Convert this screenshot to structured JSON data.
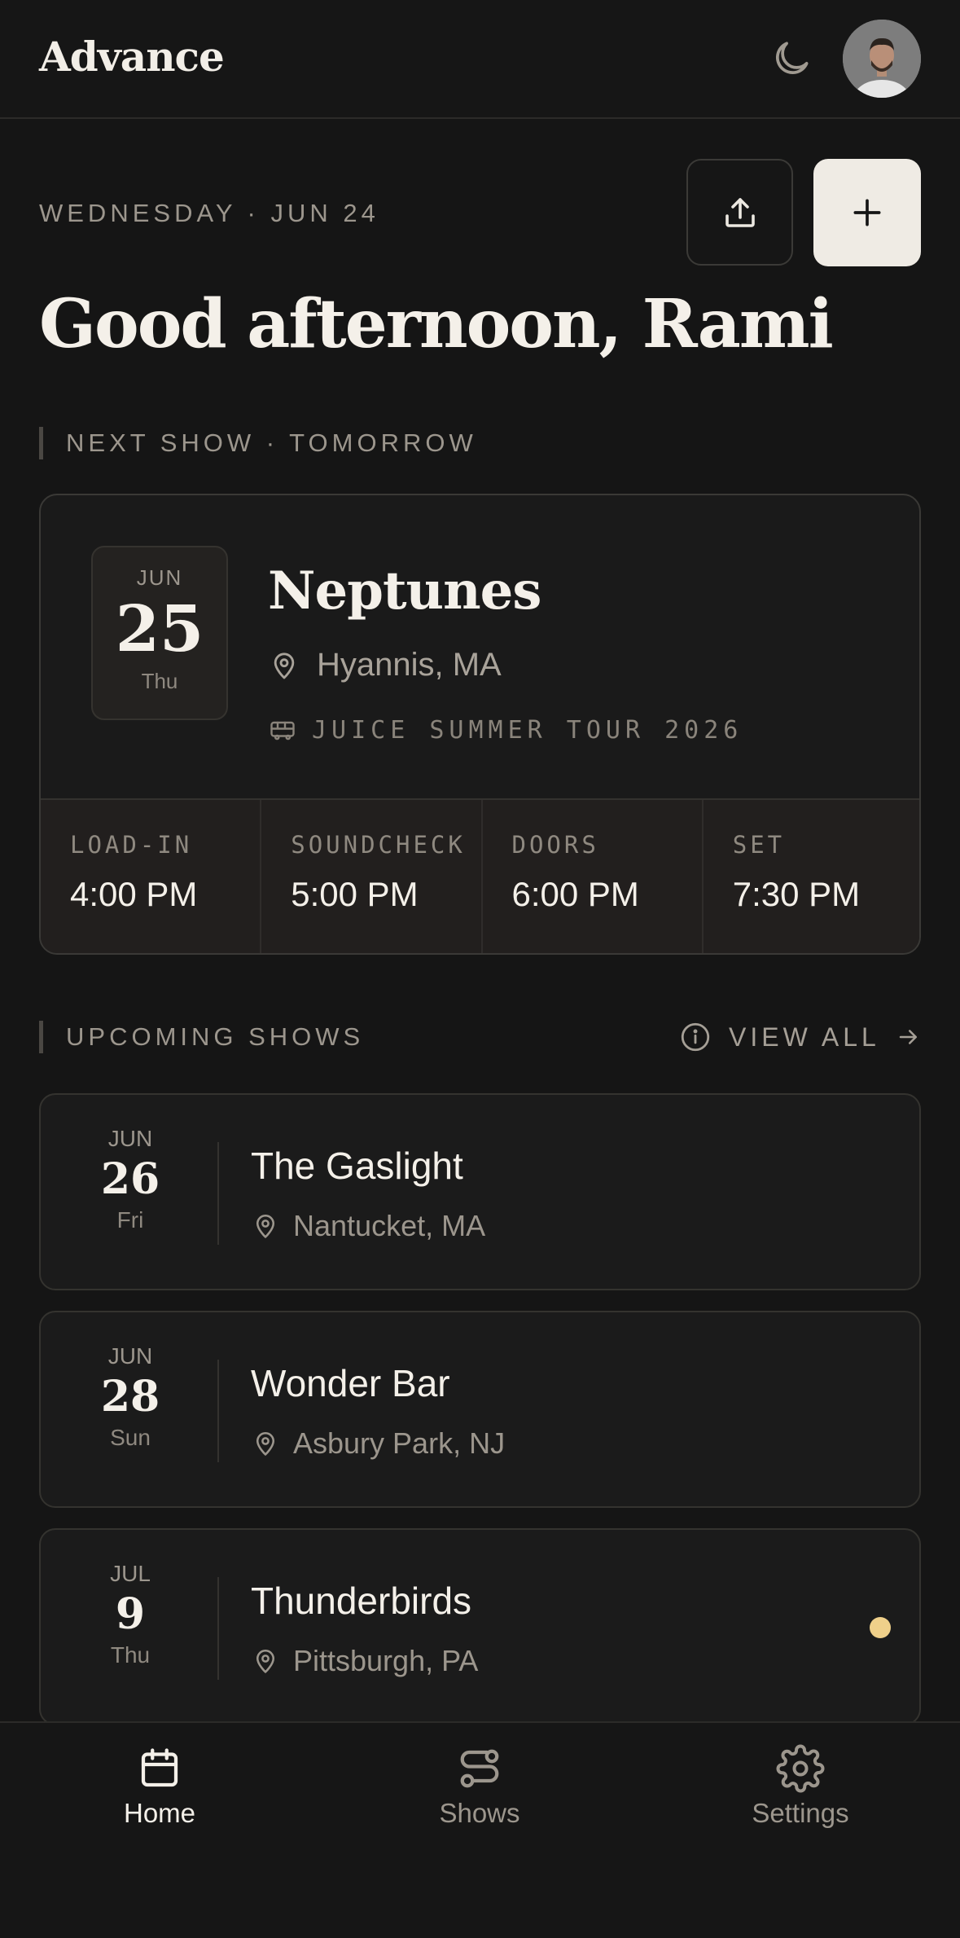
{
  "app": {
    "name": "Advance"
  },
  "header": {
    "date_line": "WEDNESDAY · JUN 24",
    "greeting": "Good afternoon, Rami"
  },
  "next_show": {
    "section_label": "NEXT SHOW · TOMORROW",
    "month": "JUN",
    "day": "25",
    "weekday": "Thu",
    "title": "Neptunes",
    "location": "Hyannis, MA",
    "tour": "JUICE SUMMER TOUR 2026",
    "times": [
      {
        "label": "LOAD-IN",
        "value": "4:00 PM"
      },
      {
        "label": "SOUNDCHECK",
        "value": "5:00 PM"
      },
      {
        "label": "DOORS",
        "value": "6:00 PM"
      },
      {
        "label": "SET",
        "value": "7:30 PM"
      }
    ]
  },
  "upcoming": {
    "section_label": "UPCOMING SHOWS",
    "view_all_label": "VIEW ALL",
    "shows": [
      {
        "month": "JUN",
        "day": "26",
        "weekday": "Fri",
        "title": "The Gaslight",
        "location": "Nantucket, MA",
        "flag": false
      },
      {
        "month": "JUN",
        "day": "28",
        "weekday": "Sun",
        "title": "Wonder Bar",
        "location": "Asbury Park, NJ",
        "flag": false
      },
      {
        "month": "JUL",
        "day": "9",
        "weekday": "Thu",
        "title": "Thunderbirds",
        "location": "Pittsburgh, PA",
        "flag": true
      }
    ]
  },
  "tabs": [
    {
      "label": "Home",
      "icon": "calendar-icon",
      "active": true
    },
    {
      "label": "Shows",
      "icon": "route-icon",
      "active": false
    },
    {
      "label": "Settings",
      "icon": "gear-icon",
      "active": false
    }
  ],
  "colors": {
    "background": "#151515",
    "primary_button": "#efebe4",
    "status_dot": "#efd08a",
    "text": "#f4f0e9",
    "muted": "#9c968d"
  }
}
